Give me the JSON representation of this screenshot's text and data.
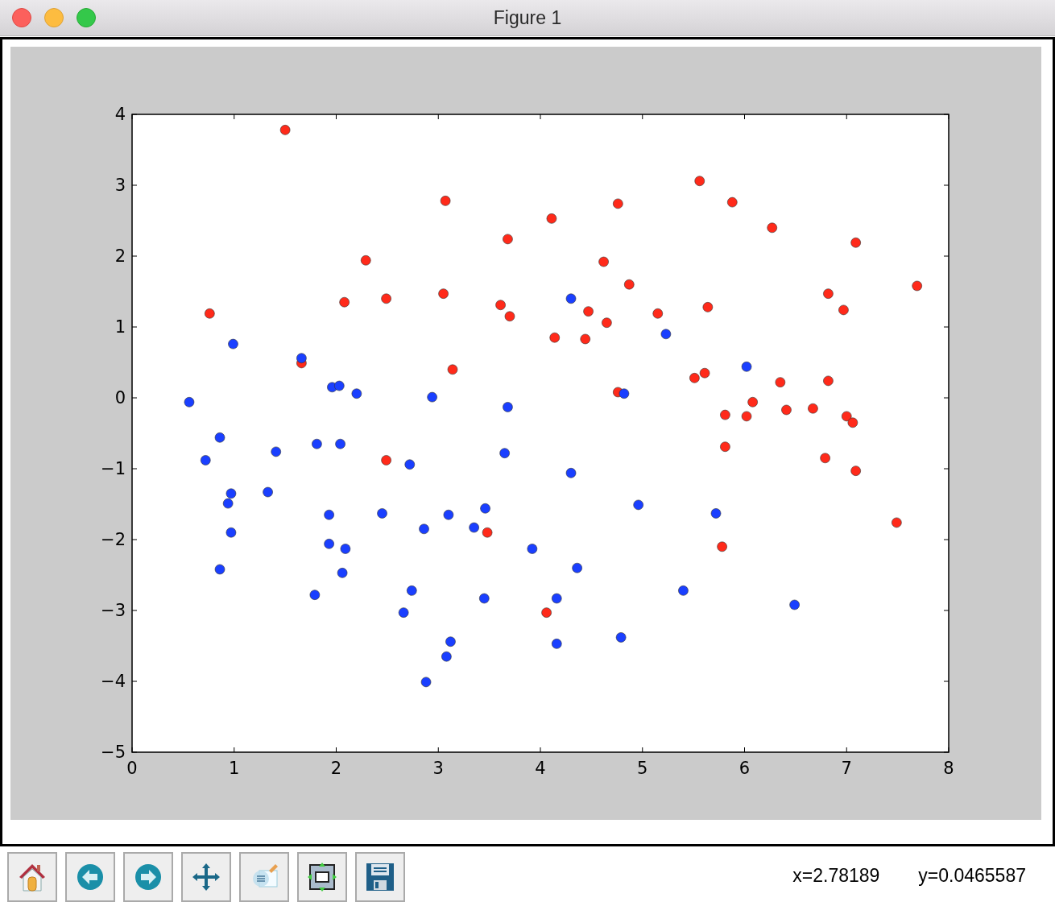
{
  "window": {
    "title": "Figure 1"
  },
  "figure": {
    "chart_data": {
      "type": "scatter",
      "xlim": [
        0,
        8
      ],
      "ylim": [
        -5,
        4
      ],
      "xticks": [
        {
          "value": 0,
          "label": "0"
        },
        {
          "value": 1,
          "label": "1"
        },
        {
          "value": 2,
          "label": "2"
        },
        {
          "value": 3,
          "label": "3"
        },
        {
          "value": 4,
          "label": "4"
        },
        {
          "value": 5,
          "label": "5"
        },
        {
          "value": 6,
          "label": "6"
        },
        {
          "value": 7,
          "label": "7"
        },
        {
          "value": 8,
          "label": "8"
        }
      ],
      "yticks": [
        {
          "value": -5,
          "label": "−5"
        },
        {
          "value": -4,
          "label": "−4"
        },
        {
          "value": -3,
          "label": "−3"
        },
        {
          "value": -2,
          "label": "−2"
        },
        {
          "value": -1,
          "label": "−1"
        },
        {
          "value": 0,
          "label": "0"
        },
        {
          "value": 1,
          "label": "1"
        },
        {
          "value": 2,
          "label": "2"
        },
        {
          "value": 3,
          "label": "3"
        },
        {
          "value": 4,
          "label": "4"
        }
      ],
      "series": [
        {
          "color": "#ff2a1a",
          "x": [
            1.5,
            0.76,
            1.66,
            2.08,
            2.29,
            2.49,
            2.49,
            3.07,
            3.05,
            3.14,
            3.48,
            3.61,
            3.68,
            3.7,
            4.06,
            4.11,
            4.14,
            4.44,
            4.47,
            4.62,
            4.65,
            4.76,
            4.76,
            4.87,
            5.15,
            5.51,
            5.56,
            5.61,
            5.64,
            5.78,
            5.81,
            5.81,
            5.88,
            6.02,
            6.08,
            6.27,
            6.35,
            6.41,
            6.67,
            6.79,
            6.82,
            6.82,
            6.97,
            7.0,
            7.06,
            7.09,
            7.09,
            7.49,
            7.69
          ],
          "values": [
            3.78,
            1.19,
            0.49,
            1.35,
            1.94,
            1.4,
            -0.88,
            2.78,
            1.47,
            0.4,
            -1.9,
            1.31,
            2.24,
            1.15,
            -3.03,
            2.53,
            0.85,
            0.83,
            1.22,
            1.92,
            1.06,
            2.74,
            0.08,
            1.6,
            1.19,
            0.28,
            3.06,
            0.35,
            1.28,
            -2.1,
            -0.24,
            -0.69,
            2.76,
            -0.26,
            -0.06,
            2.4,
            0.22,
            -0.17,
            -0.15,
            -0.85,
            1.47,
            0.24,
            1.24,
            -0.26,
            -0.35,
            2.19,
            -1.03,
            -1.76,
            1.58
          ]
        },
        {
          "color": "#1a3fff",
          "x": [
            0.56,
            0.72,
            0.86,
            0.99,
            0.97,
            0.94,
            0.97,
            0.86,
            1.41,
            1.33,
            1.66,
            1.81,
            1.79,
            1.93,
            1.93,
            1.96,
            2.03,
            2.04,
            2.06,
            2.09,
            2.2,
            2.45,
            2.66,
            2.72,
            2.74,
            2.86,
            2.94,
            2.88,
            3.08,
            3.1,
            3.12,
            3.35,
            3.45,
            3.46,
            3.65,
            3.68,
            3.92,
            4.16,
            4.16,
            4.3,
            4.3,
            4.36,
            4.82,
            4.79,
            4.96,
            5.23,
            5.4,
            5.72,
            6.02,
            6.49
          ],
          "values": [
            -0.06,
            -0.88,
            -0.56,
            0.76,
            -1.35,
            -1.49,
            -1.9,
            -2.42,
            -0.76,
            -1.33,
            0.56,
            -0.65,
            -2.78,
            -1.65,
            -2.06,
            0.15,
            0.17,
            -0.65,
            -2.47,
            -2.13,
            0.06,
            -1.63,
            -3.03,
            -0.94,
            -2.72,
            -1.85,
            0.01,
            -4.01,
            -3.65,
            -1.65,
            -3.44,
            -1.83,
            -2.83,
            -1.56,
            -0.78,
            -0.13,
            -2.13,
            -2.83,
            -3.47,
            1.4,
            -1.06,
            -2.4,
            0.06,
            -3.38,
            -1.51,
            0.9,
            -2.72,
            -1.63,
            0.44,
            -2.92
          ]
        }
      ]
    }
  },
  "toolbar": {
    "tools": [
      {
        "kind": "home"
      },
      {
        "kind": "back"
      },
      {
        "kind": "forward"
      },
      {
        "kind": "pan"
      },
      {
        "kind": "zoom"
      },
      {
        "kind": "subplots"
      },
      {
        "kind": "save"
      }
    ],
    "coordinates": [
      "x=2.78189",
      "y=0.0465587"
    ]
  }
}
